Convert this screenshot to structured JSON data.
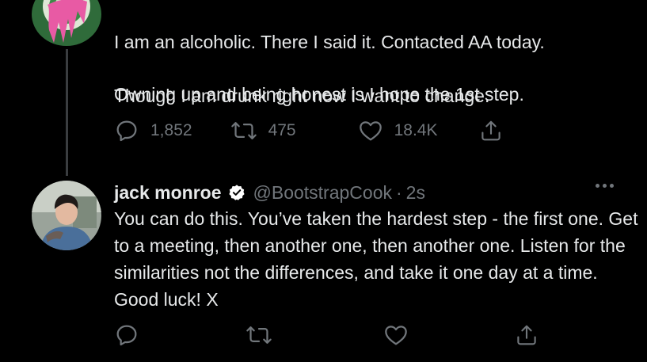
{
  "colors": {
    "background": "#000000",
    "text": "#e7e9ea",
    "muted": "#71767b",
    "thread_line": "#3a3d40",
    "verified_badge": "#ffffff"
  },
  "tweet1": {
    "text_line_1": "I am an alcoholic. There I said it. Contacted AA today.",
    "text_line_2": "Though I am drunk right now I want to change.",
    "text_line_3": "Owning up and being honest is I hope the 1st step.",
    "reply_count": "1,852",
    "retweet_count": "475",
    "like_count": "18.4K",
    "icons": [
      "reply-icon",
      "retweet-icon",
      "like-icon",
      "share-icon"
    ]
  },
  "tweet2": {
    "display_name": "jack monroe",
    "handle": "@BootstrapCook",
    "separator": "·",
    "time": "2s",
    "text": "You can do this. You’ve taken the hardest step - the first one. Get to a meeting, then another one, then another one. Listen for the similarities not the differences, and take it one day at a time. Good luck! X",
    "icons": [
      "verified-badge-icon",
      "more-icon",
      "reply-icon",
      "retweet-icon",
      "like-icon",
      "share-icon"
    ]
  }
}
